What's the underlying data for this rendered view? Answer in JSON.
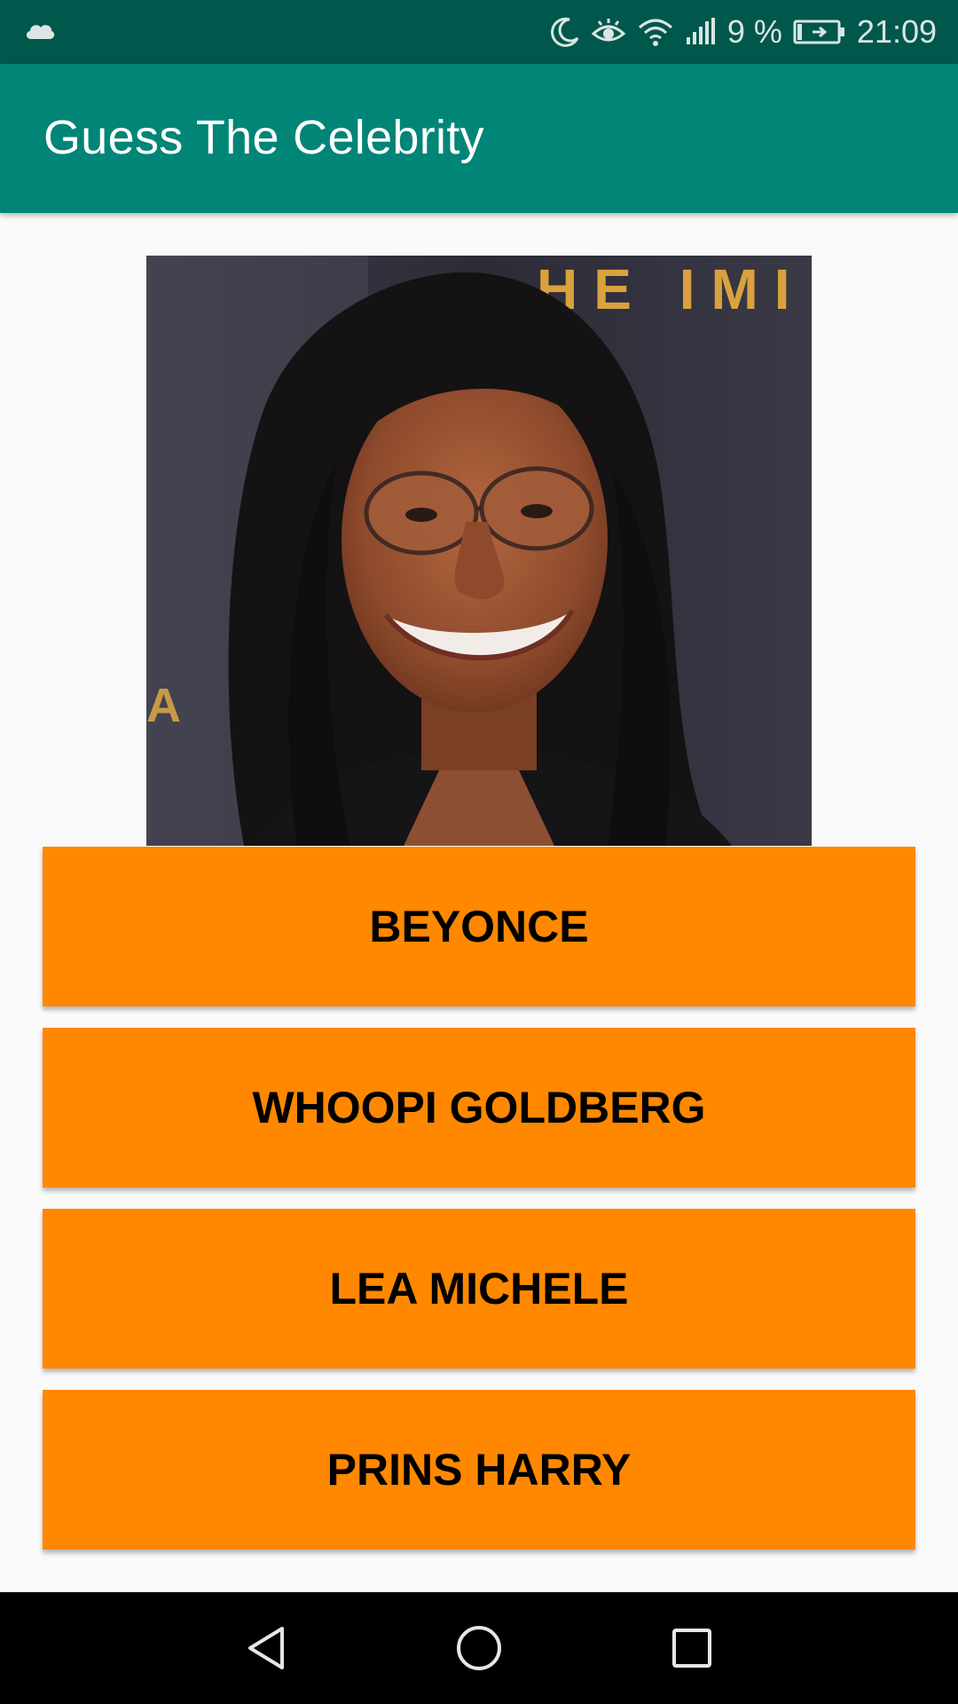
{
  "status_bar": {
    "battery": "9 %",
    "time": "21:09",
    "icons": [
      "cloud-icon",
      "moon-icon",
      "eye-icon",
      "wifi-icon",
      "signal-icon",
      "battery-icon"
    ]
  },
  "app_bar": {
    "title": "Guess The Celebrity"
  },
  "photo": {
    "subject": "celebrity-photo",
    "background_text": "HE IMI",
    "background_text_left": "A M"
  },
  "answers": [
    {
      "label": "BEYONCE"
    },
    {
      "label": "WHOOPI GOLDBERG"
    },
    {
      "label": "LEA MICHELE"
    },
    {
      "label": "PRINS HARRY"
    }
  ],
  "nav_bar": {
    "icons": [
      "back-icon",
      "home-icon",
      "recents-icon"
    ]
  },
  "colors": {
    "status_bar": "#00574b",
    "app_bar": "#008577",
    "button": "#ff8800",
    "button_text": "#000000",
    "background": "#fafafa",
    "nav_bar": "#000000"
  }
}
